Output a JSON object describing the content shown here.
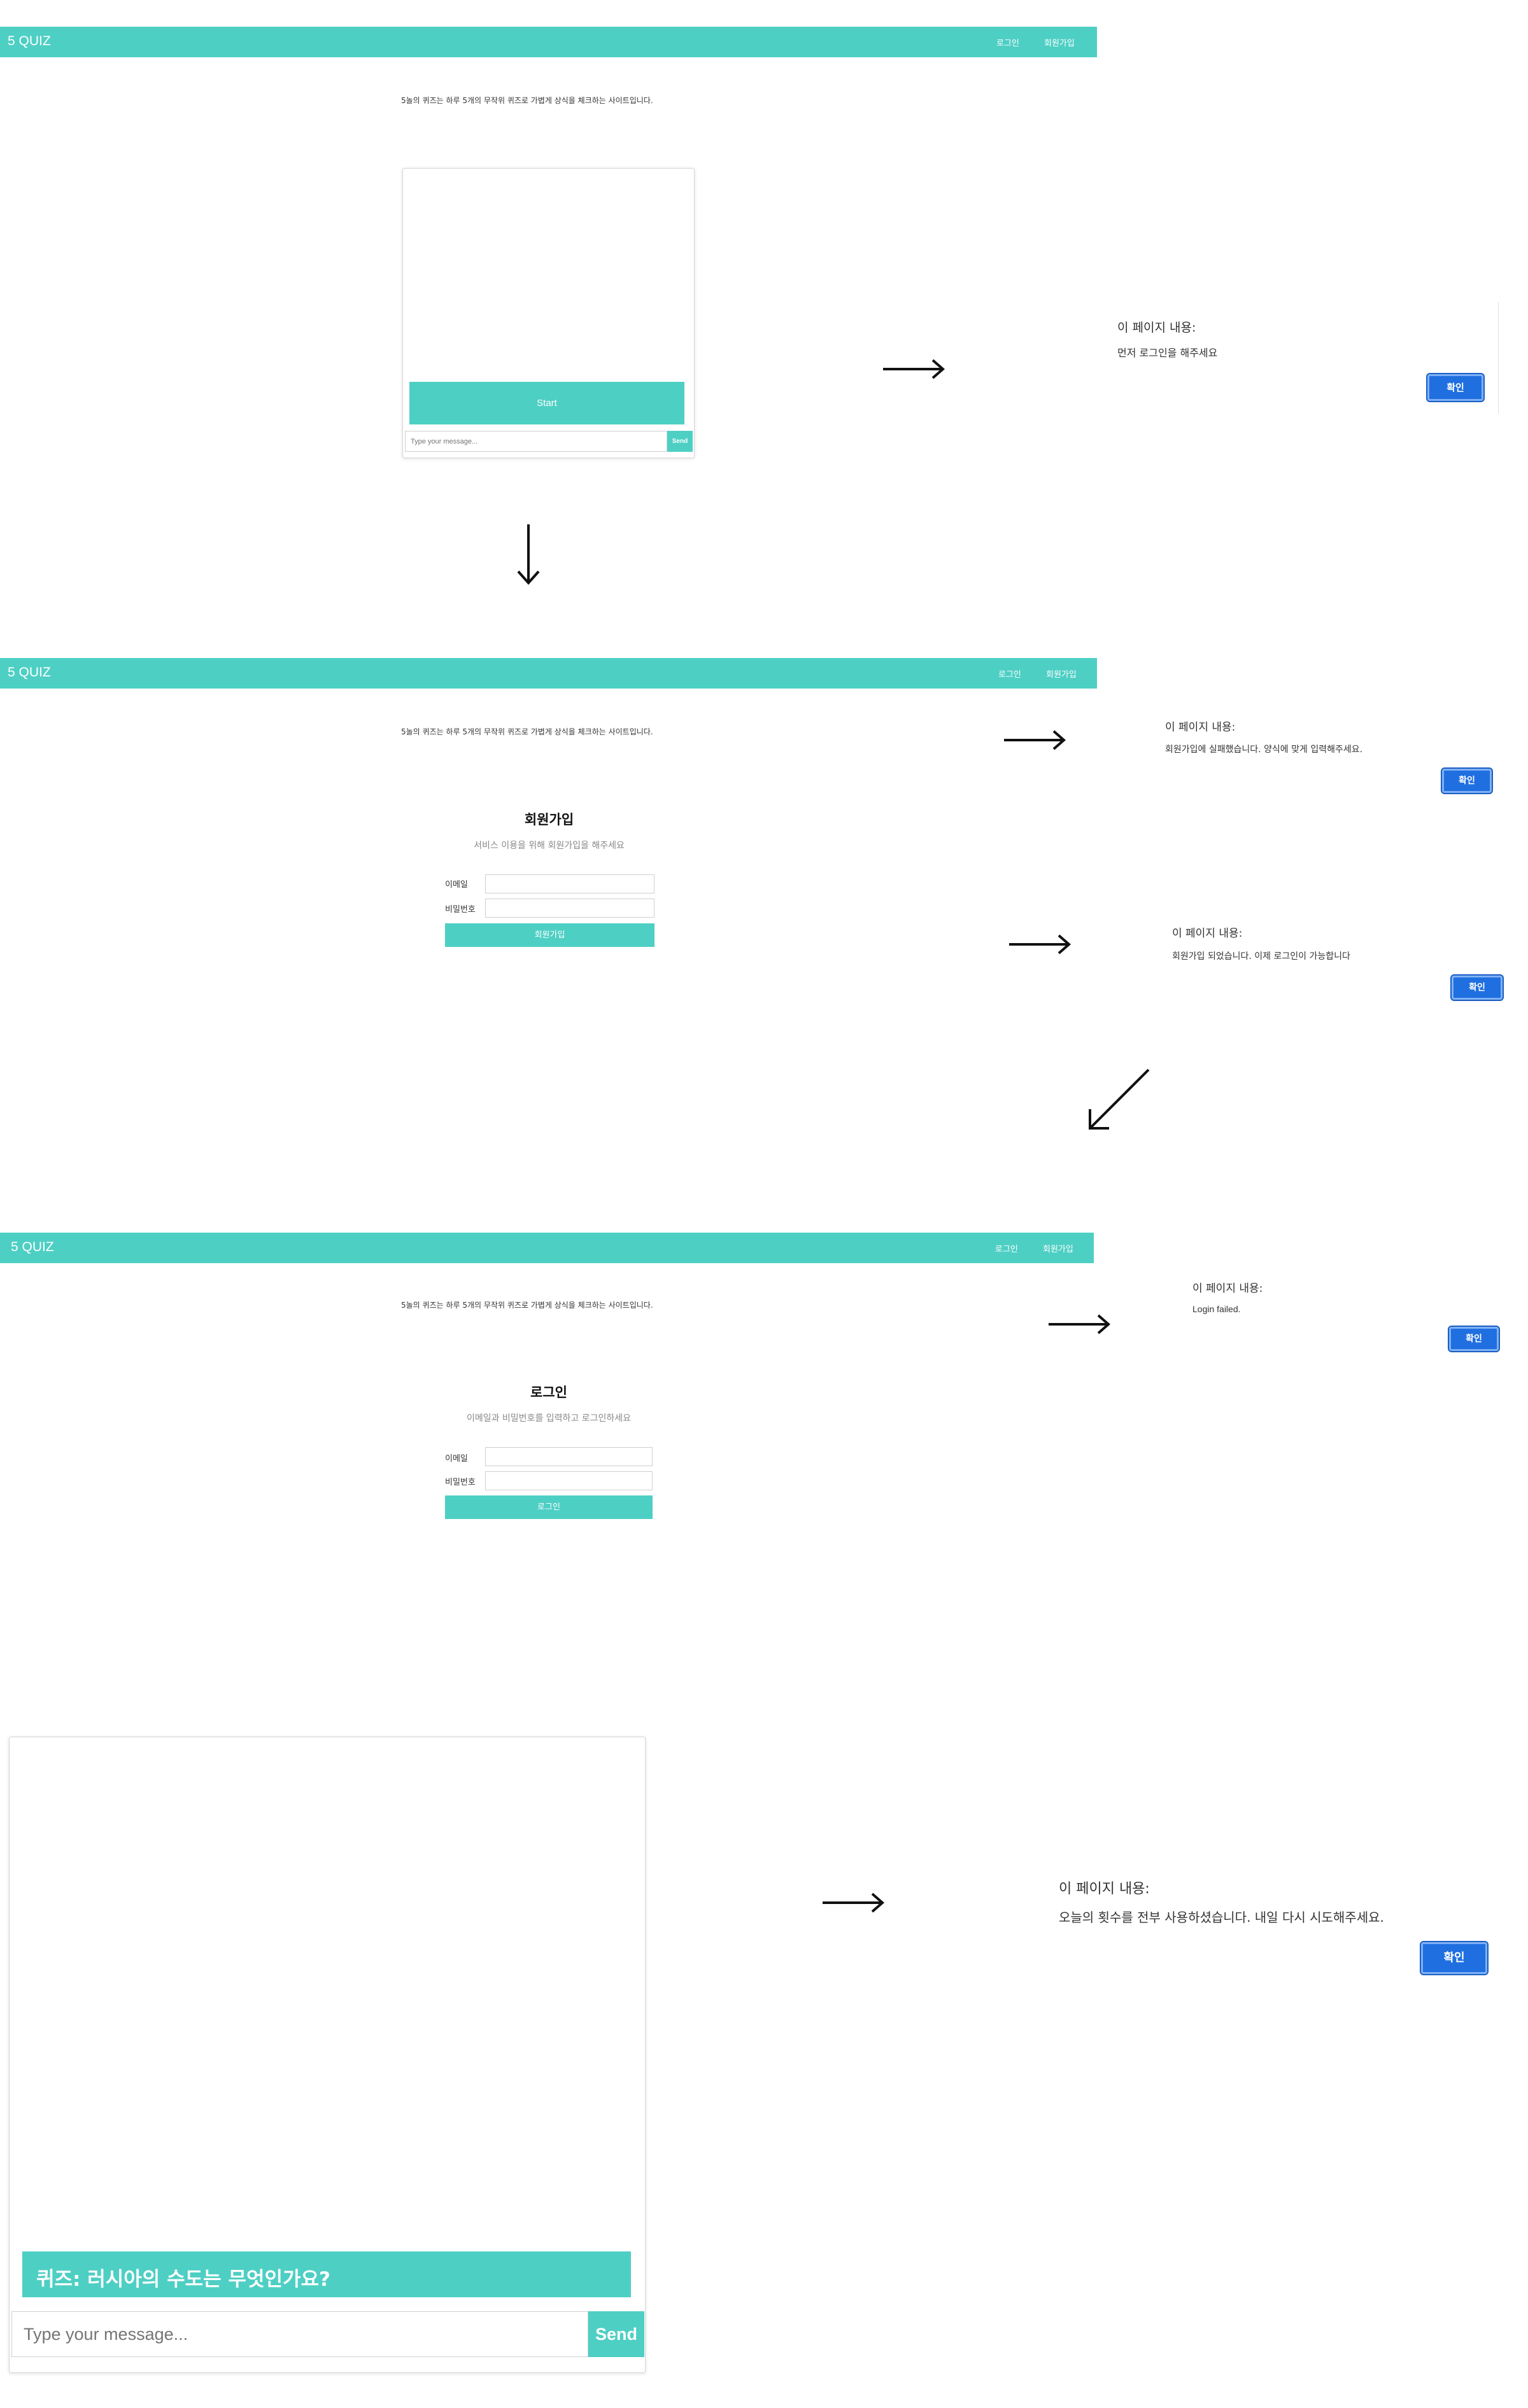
{
  "brand": "5 QUIZ",
  "nav": {
    "login": "로그인",
    "signup": "회원가입"
  },
  "description": "5놀의 퀴즈는 하루 5개의 무작위 퀴즈로 가볍게 상식을 체크하는 사이트입니다.",
  "chat": {
    "start_label": "Start",
    "placeholder": "Type your message...",
    "send_label": "Send",
    "quiz_question": "퀴즈: 러시아의 수도는 무엇인가요?"
  },
  "signup_form": {
    "title": "회원가입",
    "subtitle": "서비스 이용을 위해 회원가입을 해주세요",
    "email_label": "이메일",
    "password_label": "비밀번호",
    "submit_label": "회원가입"
  },
  "login_form": {
    "title": "로그인",
    "subtitle": "이메일과 비밀번호를 입력하고 로그인하세요",
    "email_label": "이메일",
    "password_label": "비밀번호",
    "submit_label": "로그인"
  },
  "dialogs": {
    "title": "이 페이지 내용:",
    "ok_label": "확인",
    "login_required": "먼저 로그인을 해주세요",
    "signup_failed": "회원가입에 실패했습니다. 양식에 맞게 입력해주세요.",
    "signup_success": "회원가입 되었습니다. 이제 로그인이 가능합니다",
    "login_failed": "Login failed.",
    "limit_reached": "오늘의 횟수를 전부 사용하셨습니다. 내일 다시 시도해주세요."
  },
  "colors": {
    "accent": "#4ecfc4",
    "dialog_button": "#1f6fe0",
    "background": "#ffffff"
  },
  "icons": [
    "arrow-right-icon",
    "arrow-down-icon",
    "arrow-down-left-icon"
  ]
}
